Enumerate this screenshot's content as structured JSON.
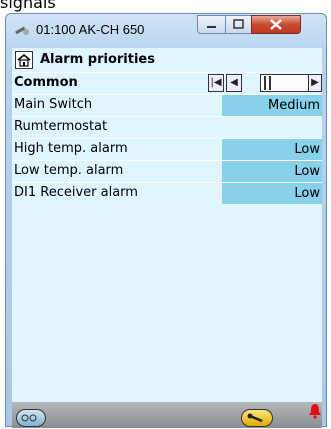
{
  "background_text": "signals",
  "window": {
    "title": "01:100 AK-CH 650",
    "controls": {
      "minimize": "—",
      "maximize": "☐",
      "close": "X"
    }
  },
  "header": {
    "title": "Alarm priorities"
  },
  "section": {
    "title": "Common"
  },
  "nav": {
    "first": "|◀",
    "prev": "◀",
    "next": "▶"
  },
  "rows": [
    {
      "label": "Main Switch",
      "value": "Medium"
    },
    {
      "label": "Rumtermostat",
      "value": ""
    },
    {
      "label": "High temp. alarm",
      "value": "Low"
    },
    {
      "label": "Low temp. alarm",
      "value": "Low"
    },
    {
      "label": "DI1 Receiver alarm",
      "value": "Low"
    }
  ]
}
